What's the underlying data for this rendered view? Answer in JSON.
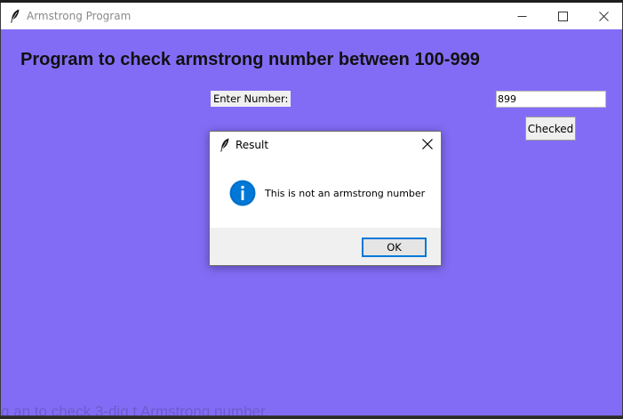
{
  "window": {
    "title": "Armstrong Program",
    "controls": [
      "minimize-icon",
      "maximize-icon",
      "close-icon"
    ]
  },
  "main": {
    "heading": "Program to check armstrong number between 100-999",
    "enter_label": "Enter Number:",
    "number_value": "899",
    "check_button_label": "Checked",
    "background_text": "g an to check 3-dig t Armstrong number"
  },
  "dialog": {
    "title": "Result",
    "icon": "info-icon",
    "message": "This is not an armstrong number",
    "ok_label": "OK"
  },
  "colors": {
    "window_background": "#836cf5",
    "titlebar": "#ffffff",
    "dialog_footer": "#f0f0f0",
    "info_icon": "#0078d7",
    "focus_border": "#0078d7"
  }
}
